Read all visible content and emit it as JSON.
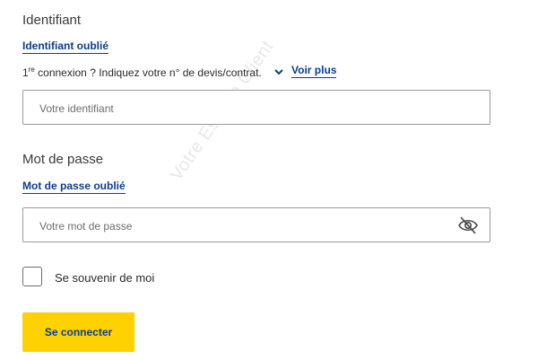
{
  "identifiant": {
    "label": "Identifiant",
    "forgot_link": "Identifiant oublié",
    "hint_prefix": "1",
    "hint_sup": "re",
    "hint_text": " connexion ? Indiquez votre n° de devis/contrat.",
    "voir_plus": "Voir plus",
    "placeholder": "Votre identifiant",
    "value": ""
  },
  "password": {
    "label": "Mot de passe",
    "forgot_link": "Mot de passe oublié",
    "placeholder": "Votre mot de passe",
    "value": "",
    "toggle_icon": "eye-slash-icon"
  },
  "remember": {
    "label": "Se souvenir de moi",
    "checked": false
  },
  "submit_label": "Se connecter",
  "watermark": "Votre Espace Client",
  "colors": {
    "link": "#0b3d91",
    "button_bg": "#ffd100"
  }
}
